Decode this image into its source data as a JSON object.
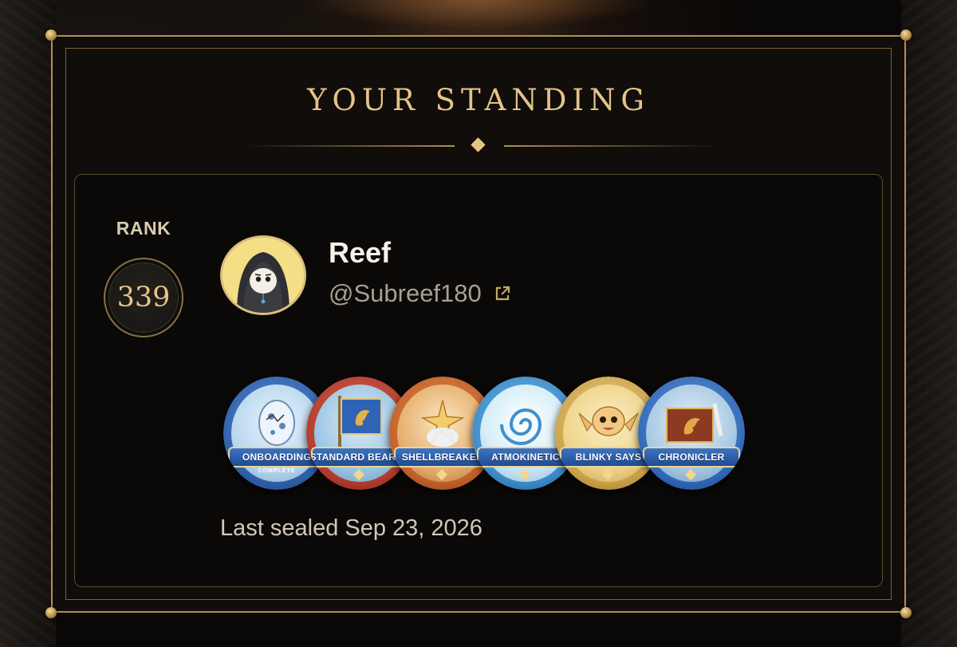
{
  "title": "YOUR STANDING",
  "rank": {
    "label": "RANK",
    "value": "339"
  },
  "profile": {
    "name": "Reef",
    "handle": "@Subreef180",
    "avatar_icon": "hooded-character-avatar",
    "external_link_icon": "external-link-icon"
  },
  "badges": [
    {
      "label": "ONBOARDING",
      "sub": "COMPLETE",
      "icon": "cracked-egg-badge",
      "ring": "#2f5fa8",
      "art": "#b9d8ef"
    },
    {
      "label": "STANDARD BEARER",
      "icon": "banner-flag-badge",
      "ring": "#b13a2d",
      "art": "#9ec7e4"
    },
    {
      "label": "SHELLBREAKER",
      "icon": "hatching-egg-badge",
      "ring": "#c1602a",
      "art": "#e6b070"
    },
    {
      "label": "ATMOKINETIC",
      "icon": "swirl-wind-badge",
      "ring": "#3b8ac7",
      "art": "#d7eef8"
    },
    {
      "label": "BLINKY SAYS",
      "icon": "baby-dragon-badge",
      "ring": "#c9a047",
      "art": "#f0d48c"
    },
    {
      "label": "CHRONICLER",
      "icon": "dragon-book-badge",
      "ring": "#2f66b5",
      "art": "#a9c9e3"
    }
  ],
  "last_sealed": "Last sealed Sep 23, 2026",
  "colors": {
    "gold": "#e6c487",
    "frame": "#b58f52",
    "background": "#100d0b"
  }
}
